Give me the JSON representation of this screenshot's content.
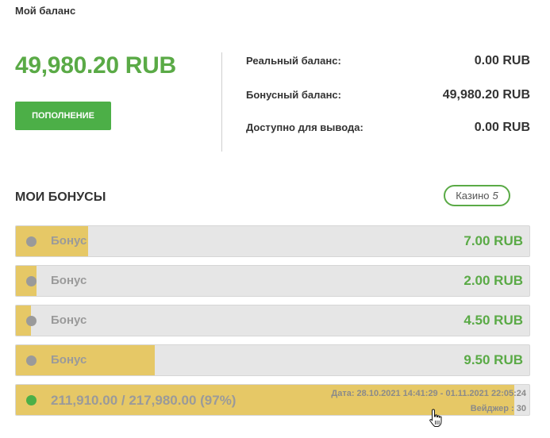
{
  "page_title": "Мой баланс",
  "balance": {
    "total": "49,980.20 RUB",
    "deposit_label": "ПОПОЛНЕНИЕ",
    "rows": [
      {
        "label": "Реальный баланс:",
        "value": "0.00 RUB"
      },
      {
        "label": "Бонусный баланс:",
        "value": "49,980.20 RUB"
      },
      {
        "label": "Доступно для вывода:",
        "value": "0.00 RUB"
      }
    ]
  },
  "bonuses": {
    "title": "МОИ БОНУСЫ",
    "filter": {
      "label": "Казино",
      "count": "5"
    },
    "items": [
      {
        "name": "Бонус",
        "amount": "7.00 RUB",
        "progress": 0.14
      },
      {
        "name": "Бонус",
        "amount": "2.00 RUB",
        "progress": 0.04
      },
      {
        "name": "Бонус",
        "amount": "4.50 RUB",
        "progress": 0.03
      },
      {
        "name": "Бонус",
        "amount": "9.50 RUB",
        "progress": 0.27
      }
    ],
    "active": {
      "progress_text": "211,910.00 / 217,980.00 (97%)",
      "progress": 0.97,
      "date_text": "Дата: 28.10.2021 14:41:29 - 01.11.2021 22:05:24",
      "wager_text": "Вейджер : 30"
    }
  },
  "colors": {
    "accent": "#5aaa46",
    "button": "#4caf47",
    "bar_fill": "#e6c866",
    "bar_bg": "#e6e6e6"
  },
  "icons": {
    "status_dot": "circle",
    "cursor": "hand-pointer-icon"
  }
}
